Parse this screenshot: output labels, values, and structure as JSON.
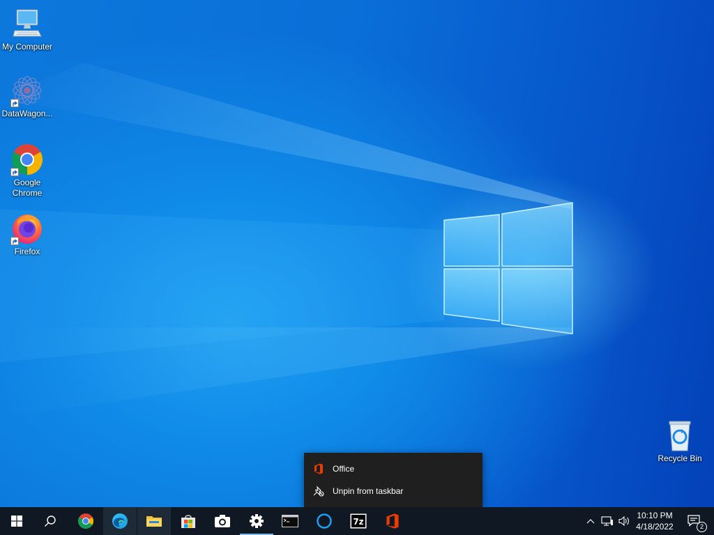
{
  "desktop": {
    "icons": [
      {
        "label": "My Computer",
        "icon": "monitor-icon"
      },
      {
        "label": "DataWagon...",
        "icon": "datawagon-icon"
      },
      {
        "label": "Google\nChrome",
        "icon": "chrome-icon"
      },
      {
        "label": "Firefox",
        "icon": "firefox-icon"
      },
      {
        "label": "Recycle Bin",
        "icon": "recycle-bin-icon"
      }
    ]
  },
  "context_menu": {
    "items": [
      {
        "label": "Office",
        "icon": "office-icon"
      },
      {
        "label": "Unpin from taskbar",
        "icon": "unpin-icon"
      }
    ]
  },
  "taskbar": {
    "buttons": [
      "start-icon",
      "search-icon",
      "chrome-icon",
      "edge-icon",
      "file-explorer-icon",
      "microsoft-store-icon",
      "camera-icon",
      "settings-icon",
      "terminal-icon",
      "cortana-icon",
      "7zip-icon",
      "office-icon"
    ],
    "tray": {
      "time": "10:10 PM",
      "date": "4/18/2022",
      "notification_count": "2"
    }
  },
  "colors": {
    "desktop_blue": "#0a64d4",
    "taskbar": "#101923",
    "menu_bg": "#1f1f1f",
    "office_orange": "#eb3c00",
    "active_underline": "#76b9ed"
  }
}
